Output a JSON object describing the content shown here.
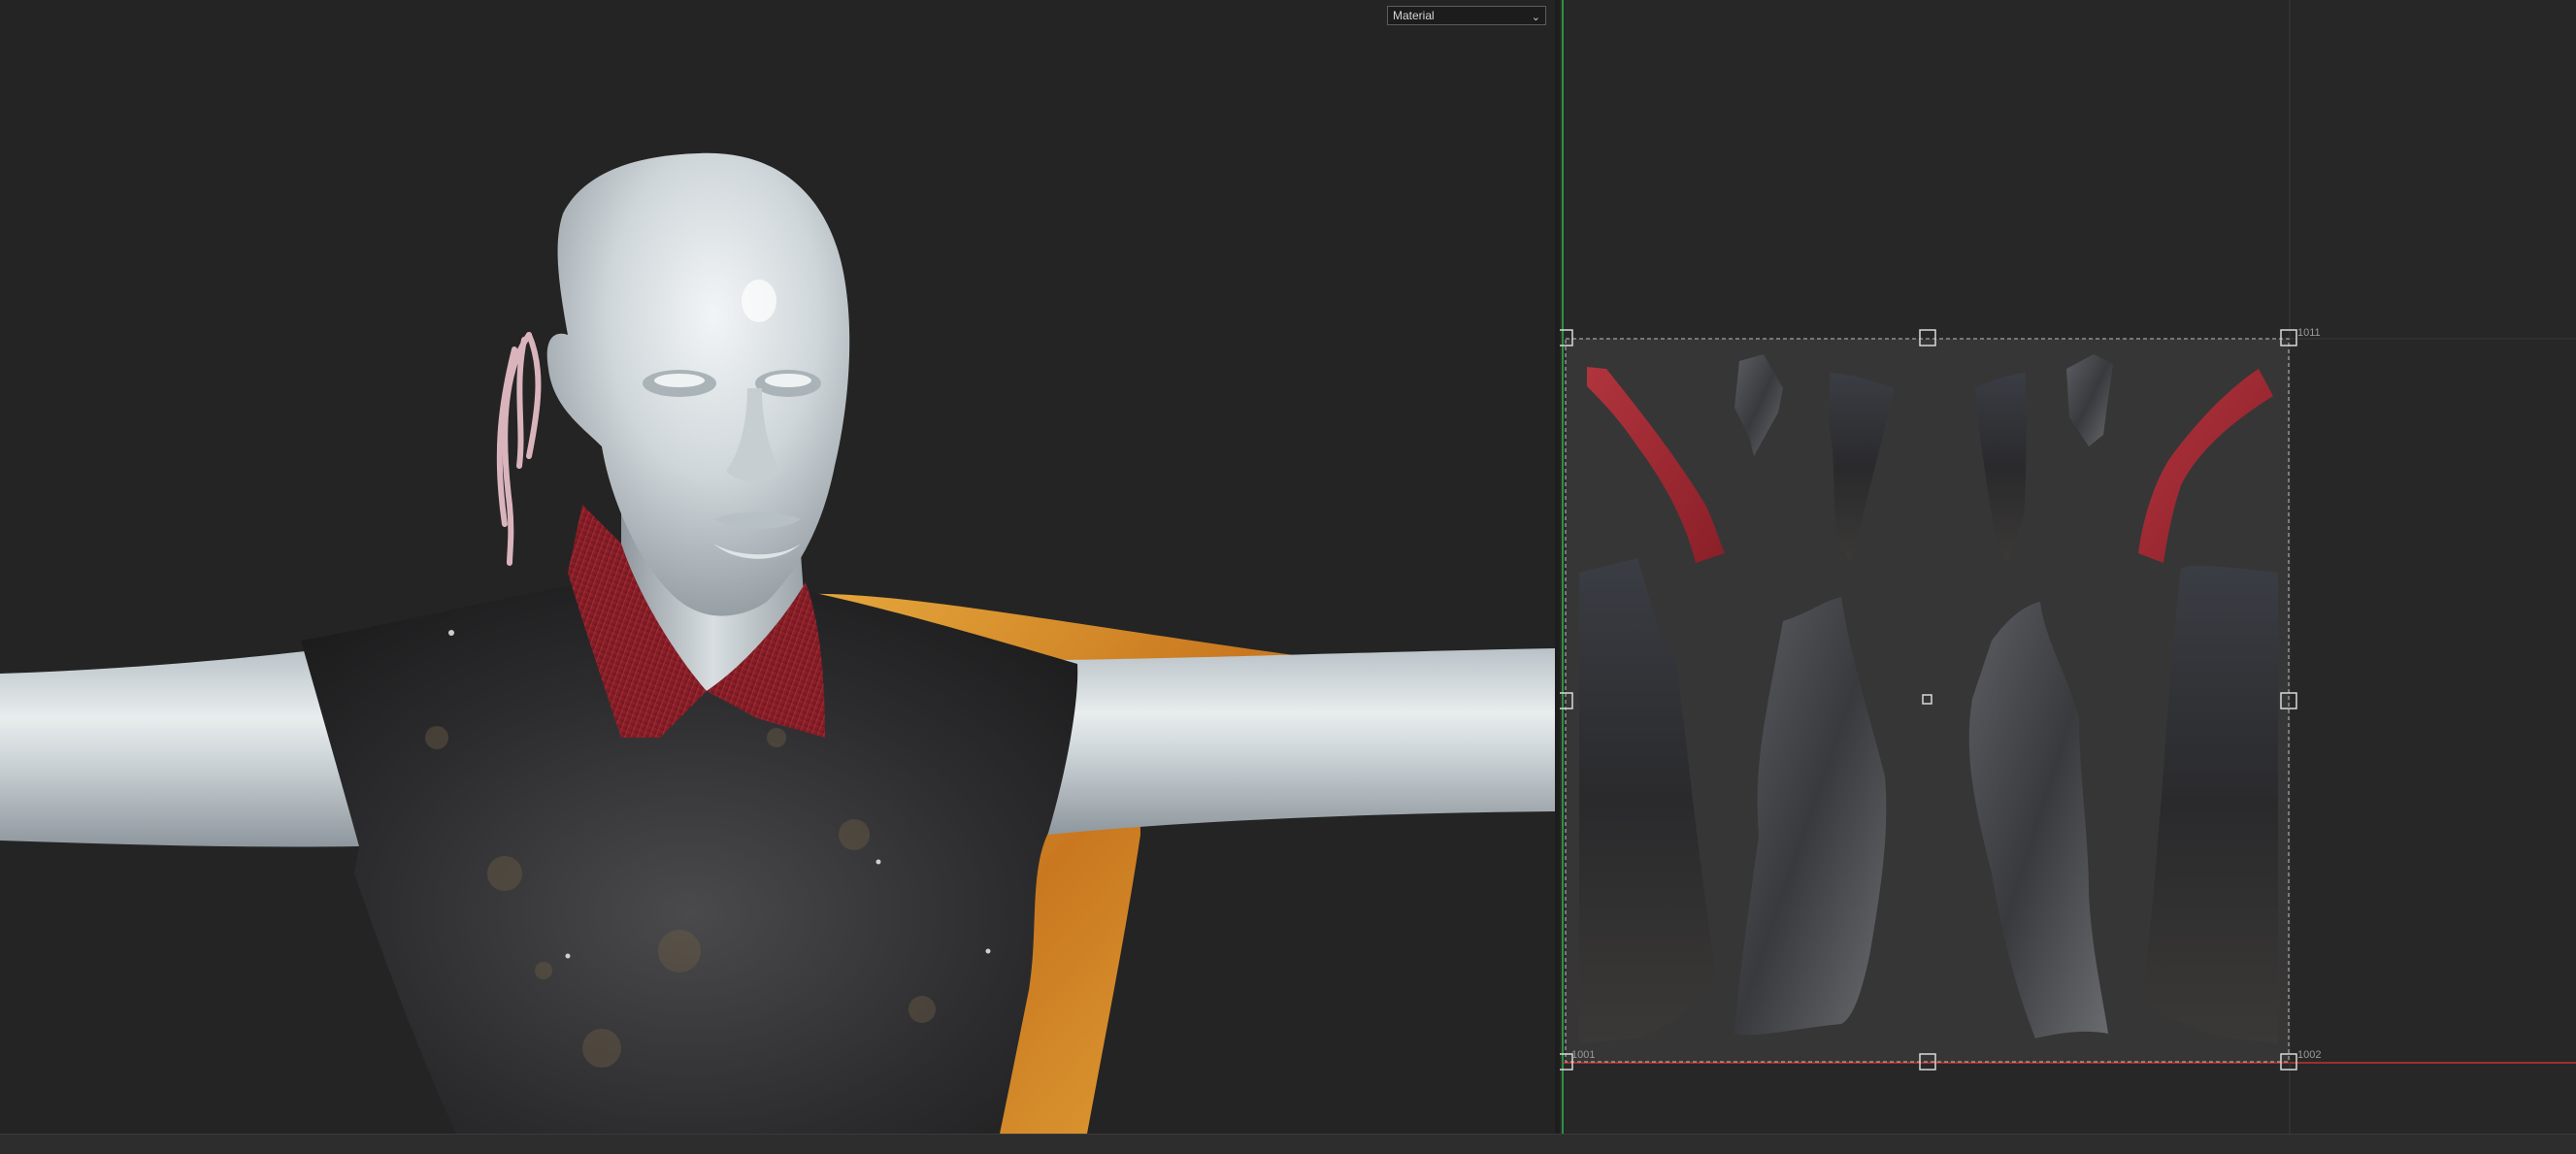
{
  "viewport3d": {
    "shading_mode": {
      "selected": "Material",
      "icon": "chevron-down-icon"
    }
  },
  "viewport2d": {
    "uv_tile": {
      "label": "1001",
      "neighbor_label_top": "1011",
      "neighbor_label_bottom": "1002"
    }
  },
  "colors": {
    "background": "#242424",
    "uv_tile_background": "#363636",
    "u_axis": "#c23333",
    "v_axis": "#2fb34a",
    "mannequin_skin": "#c9d0d4",
    "shirt": "#2b2b2d",
    "collar": "#8f1f28",
    "cape": "#d8922e"
  }
}
